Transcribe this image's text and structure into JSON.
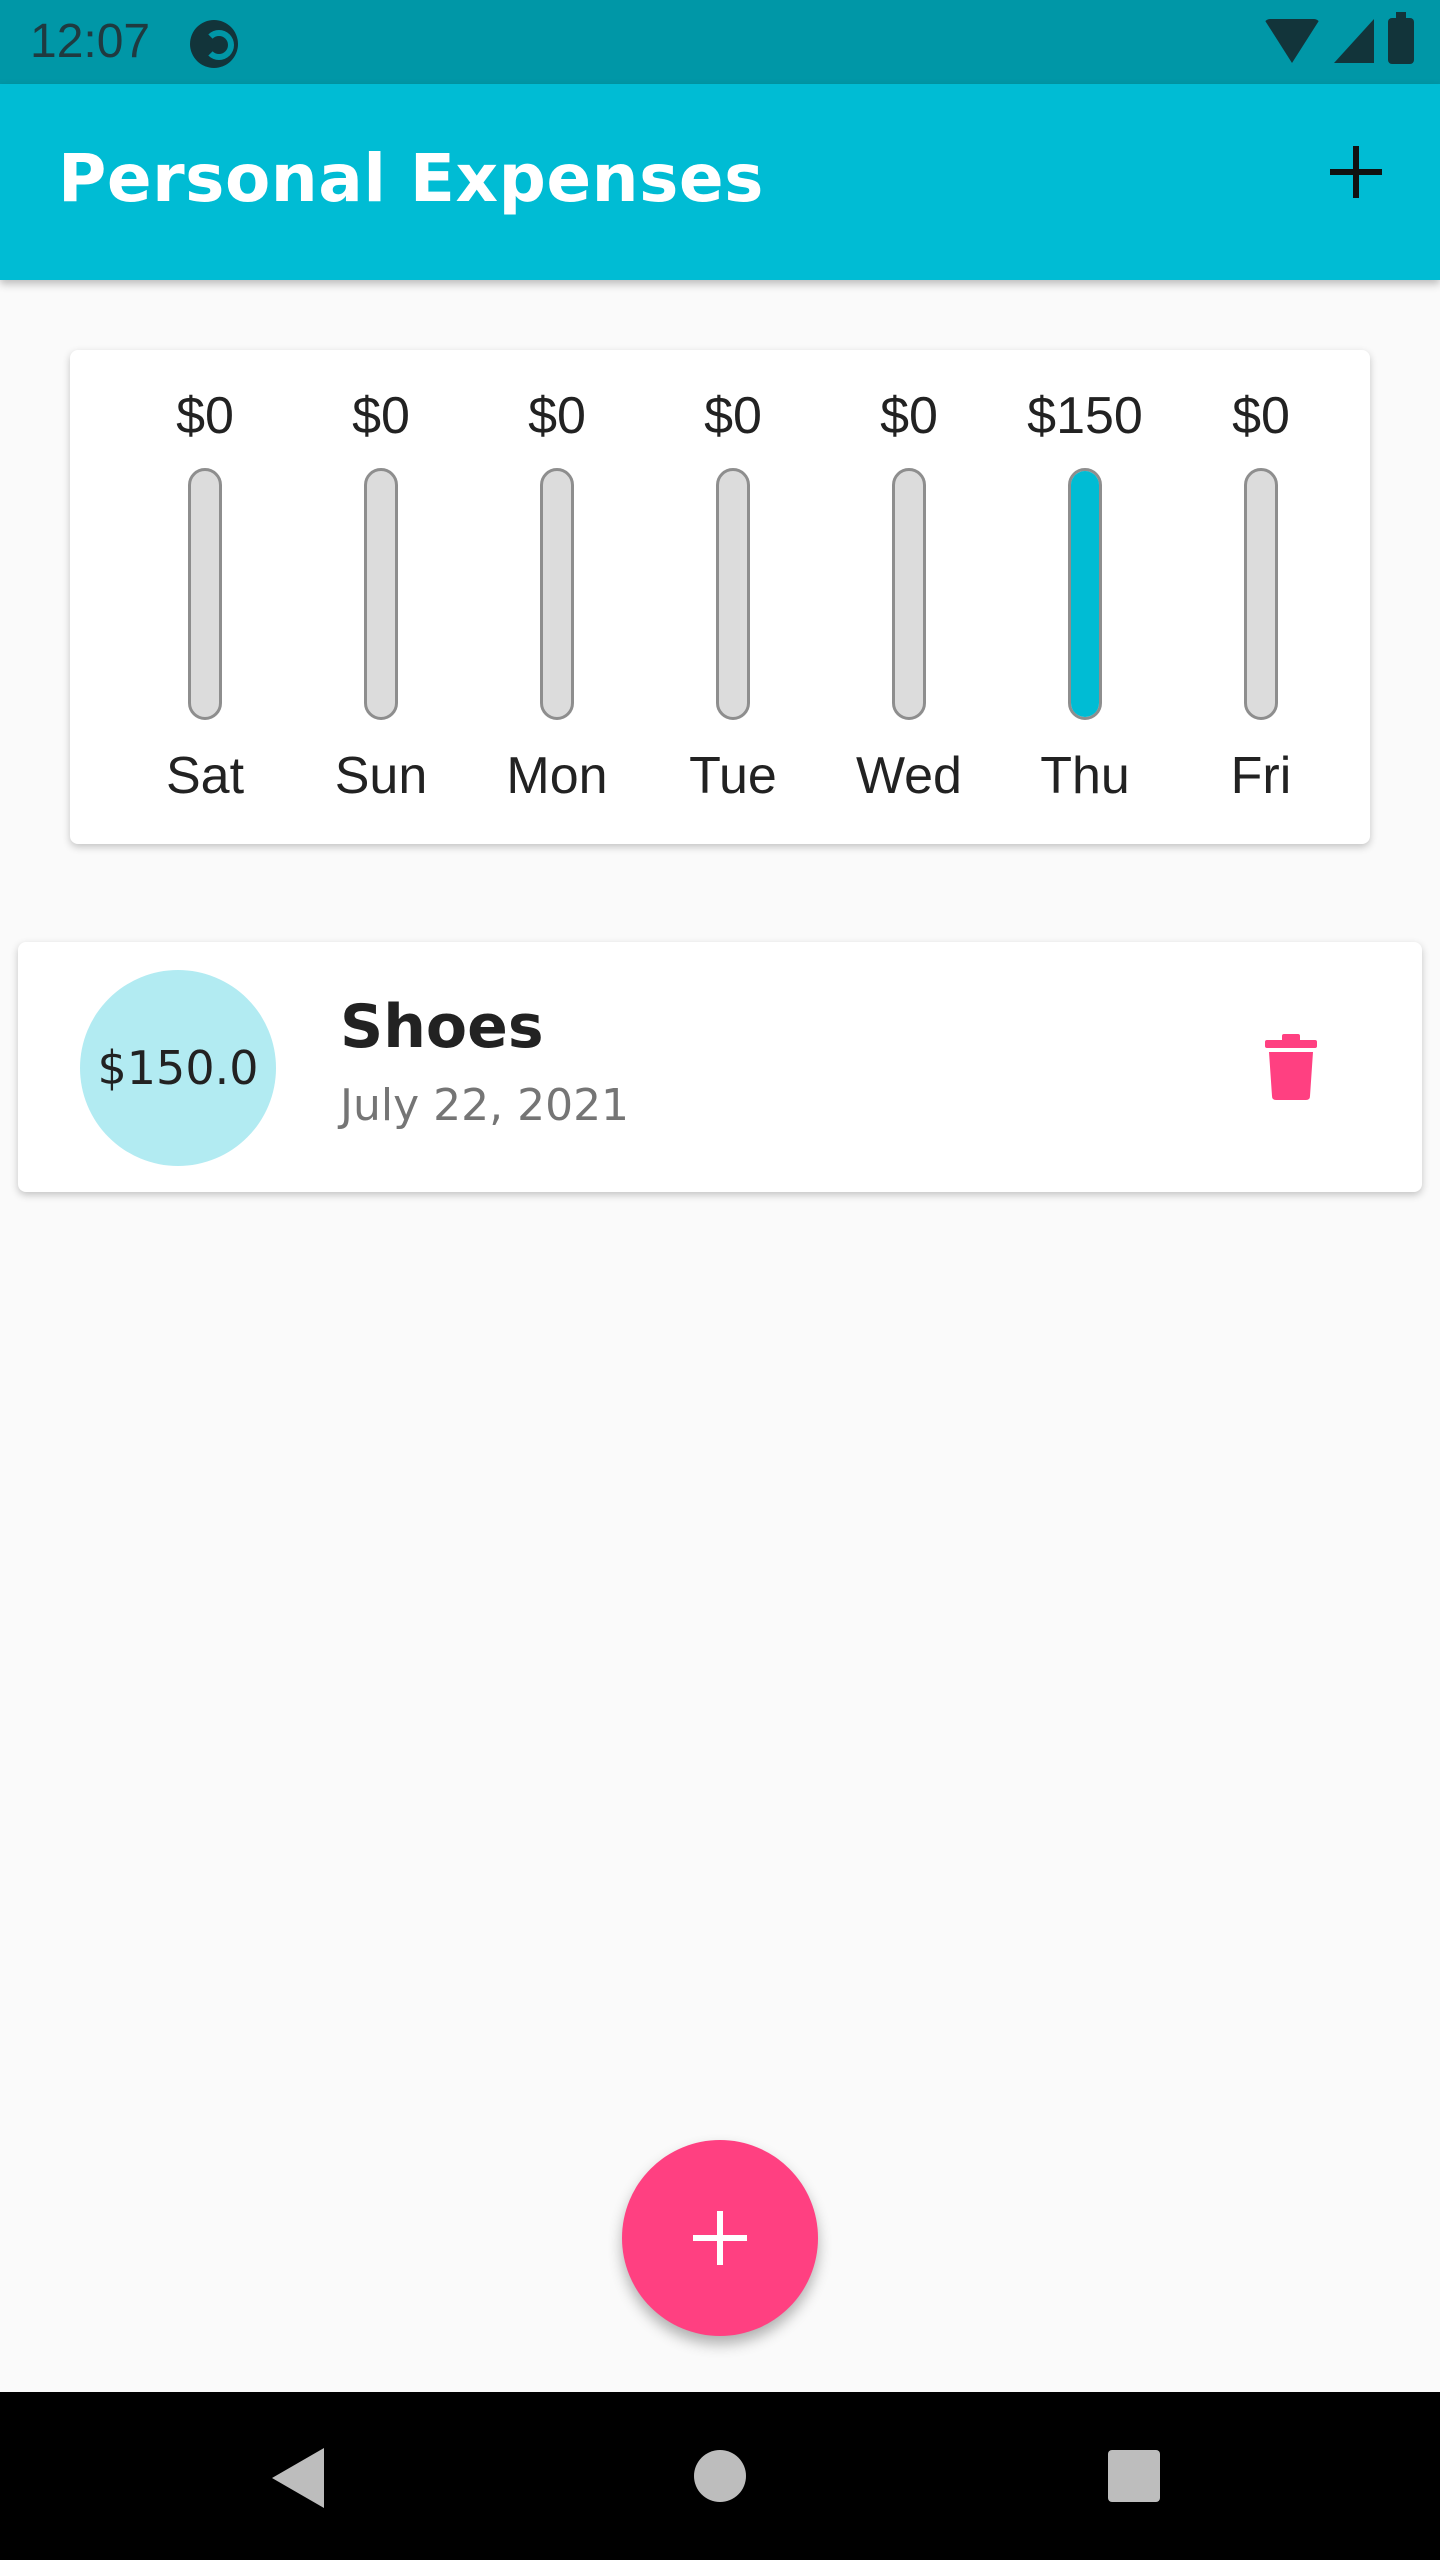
{
  "status_bar": {
    "time": "12:07",
    "icons": [
      "app-notification-icon",
      "wifi-icon",
      "signal-icon",
      "battery-icon"
    ]
  },
  "app_bar": {
    "title": "Personal Expenses",
    "action_icon": "plus-icon",
    "color": "#00bcd4"
  },
  "chart": {
    "bars": [
      {
        "day": "Sat",
        "amount": "$0",
        "fraction": 0
      },
      {
        "day": "Sun",
        "amount": "$0",
        "fraction": 0
      },
      {
        "day": "Mon",
        "amount": "$0",
        "fraction": 0
      },
      {
        "day": "Tue",
        "amount": "$0",
        "fraction": 0
      },
      {
        "day": "Wed",
        "amount": "$0",
        "fraction": 0
      },
      {
        "day": "Thu",
        "amount": "$150",
        "fraction": 1
      },
      {
        "day": "Fri",
        "amount": "$0",
        "fraction": 0
      }
    ],
    "fill_color": "#00bcd4",
    "track_color": "#dcdcdc"
  },
  "transactions": [
    {
      "amount": "$150.0",
      "title": "Shoes",
      "date": "July 22, 2021",
      "delete_icon": "trash-icon",
      "delete_color": "#ff4081"
    }
  ],
  "fab": {
    "icon": "plus-icon",
    "color": "#ff4081"
  },
  "nav_bar": {
    "icons": [
      "back-icon",
      "home-icon",
      "recents-icon"
    ]
  }
}
